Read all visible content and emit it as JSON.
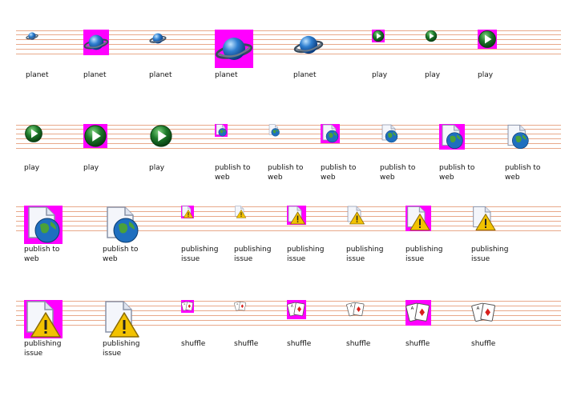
{
  "labels": {
    "planet": "planet",
    "play": "play",
    "publish": "publish to\nweb",
    "issue": "publishing\nissue",
    "shuffle": "shuffle"
  },
  "colors": {
    "guide_line": "#e8a98a",
    "mask": "#ff00ff",
    "planet_blue": "#2f7fd0",
    "play_green": "#1d7a2a",
    "warning_yellow": "#f2c200"
  },
  "rows": [
    [
      {
        "icon": "planet",
        "label": "planet",
        "mask": false
      },
      {
        "icon": "planet",
        "label": "planet",
        "mask": true
      },
      {
        "icon": "planet",
        "label": "planet",
        "mask": false
      },
      {
        "icon": "planet",
        "label": "planet",
        "mask": true
      },
      {
        "icon": "planet",
        "label": "planet",
        "mask": false
      },
      {
        "icon": "play",
        "label": "play",
        "mask": true
      },
      {
        "icon": "play",
        "label": "play",
        "mask": false
      },
      {
        "icon": "play",
        "label": "play",
        "mask": true
      }
    ],
    [
      {
        "icon": "play",
        "label": "play",
        "mask": false
      },
      {
        "icon": "play",
        "label": "play",
        "mask": true
      },
      {
        "icon": "play",
        "label": "play",
        "mask": false
      },
      {
        "icon": "publish",
        "label": "publish",
        "mask": true
      },
      {
        "icon": "publish",
        "label": "publish",
        "mask": false
      },
      {
        "icon": "publish",
        "label": "publish",
        "mask": true
      },
      {
        "icon": "publish",
        "label": "publish",
        "mask": false
      },
      {
        "icon": "publish",
        "label": "publish",
        "mask": true
      },
      {
        "icon": "publish",
        "label": "publish",
        "mask": false
      }
    ],
    [
      {
        "icon": "publish",
        "label": "publish",
        "mask": true
      },
      {
        "icon": "publish",
        "label": "publish",
        "mask": false
      },
      {
        "icon": "issue",
        "label": "issue",
        "mask": true
      },
      {
        "icon": "issue",
        "label": "issue",
        "mask": false
      },
      {
        "icon": "issue",
        "label": "issue",
        "mask": true
      },
      {
        "icon": "issue",
        "label": "issue",
        "mask": false
      },
      {
        "icon": "issue",
        "label": "issue",
        "mask": true
      },
      {
        "icon": "issue",
        "label": "issue",
        "mask": false
      }
    ],
    [
      {
        "icon": "issue",
        "label": "issue",
        "mask": true
      },
      {
        "icon": "issue",
        "label": "issue",
        "mask": false
      },
      {
        "icon": "shuffle",
        "label": "shuffle",
        "mask": true
      },
      {
        "icon": "shuffle",
        "label": "shuffle",
        "mask": false
      },
      {
        "icon": "shuffle",
        "label": "shuffle",
        "mask": true
      },
      {
        "icon": "shuffle",
        "label": "shuffle",
        "mask": false
      },
      {
        "icon": "shuffle",
        "label": "shuffle",
        "mask": true
      },
      {
        "icon": "shuffle",
        "label": "shuffle",
        "mask": false
      }
    ]
  ]
}
